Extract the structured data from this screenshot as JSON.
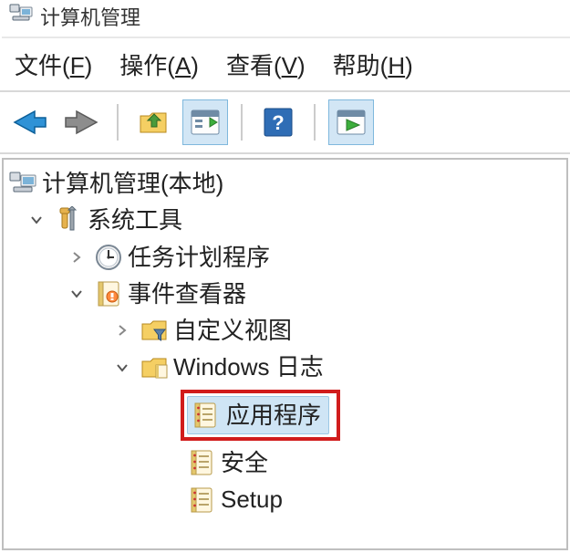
{
  "title": "计算机管理",
  "menu": {
    "file": {
      "label": "文件",
      "accel": "F"
    },
    "action": {
      "label": "操作",
      "accel": "A"
    },
    "view": {
      "label": "查看",
      "accel": "V"
    },
    "help": {
      "label": "帮助",
      "accel": "H"
    }
  },
  "toolbar": {
    "back": "back-icon",
    "forward": "forward-icon",
    "up": "folder-up-icon",
    "props": "properties-icon",
    "help": "help-icon",
    "run": "run-icon"
  },
  "tree": {
    "root": {
      "label": "计算机管理(本地)"
    },
    "system_tools": {
      "label": "系统工具"
    },
    "task_scheduler": {
      "label": "任务计划程序"
    },
    "event_viewer": {
      "label": "事件查看器"
    },
    "custom_views": {
      "label": "自定义视图"
    },
    "windows_logs": {
      "label": "Windows 日志"
    },
    "application": {
      "label": "应用程序"
    },
    "security": {
      "label": "安全"
    },
    "setup": {
      "label": "Setup"
    }
  }
}
